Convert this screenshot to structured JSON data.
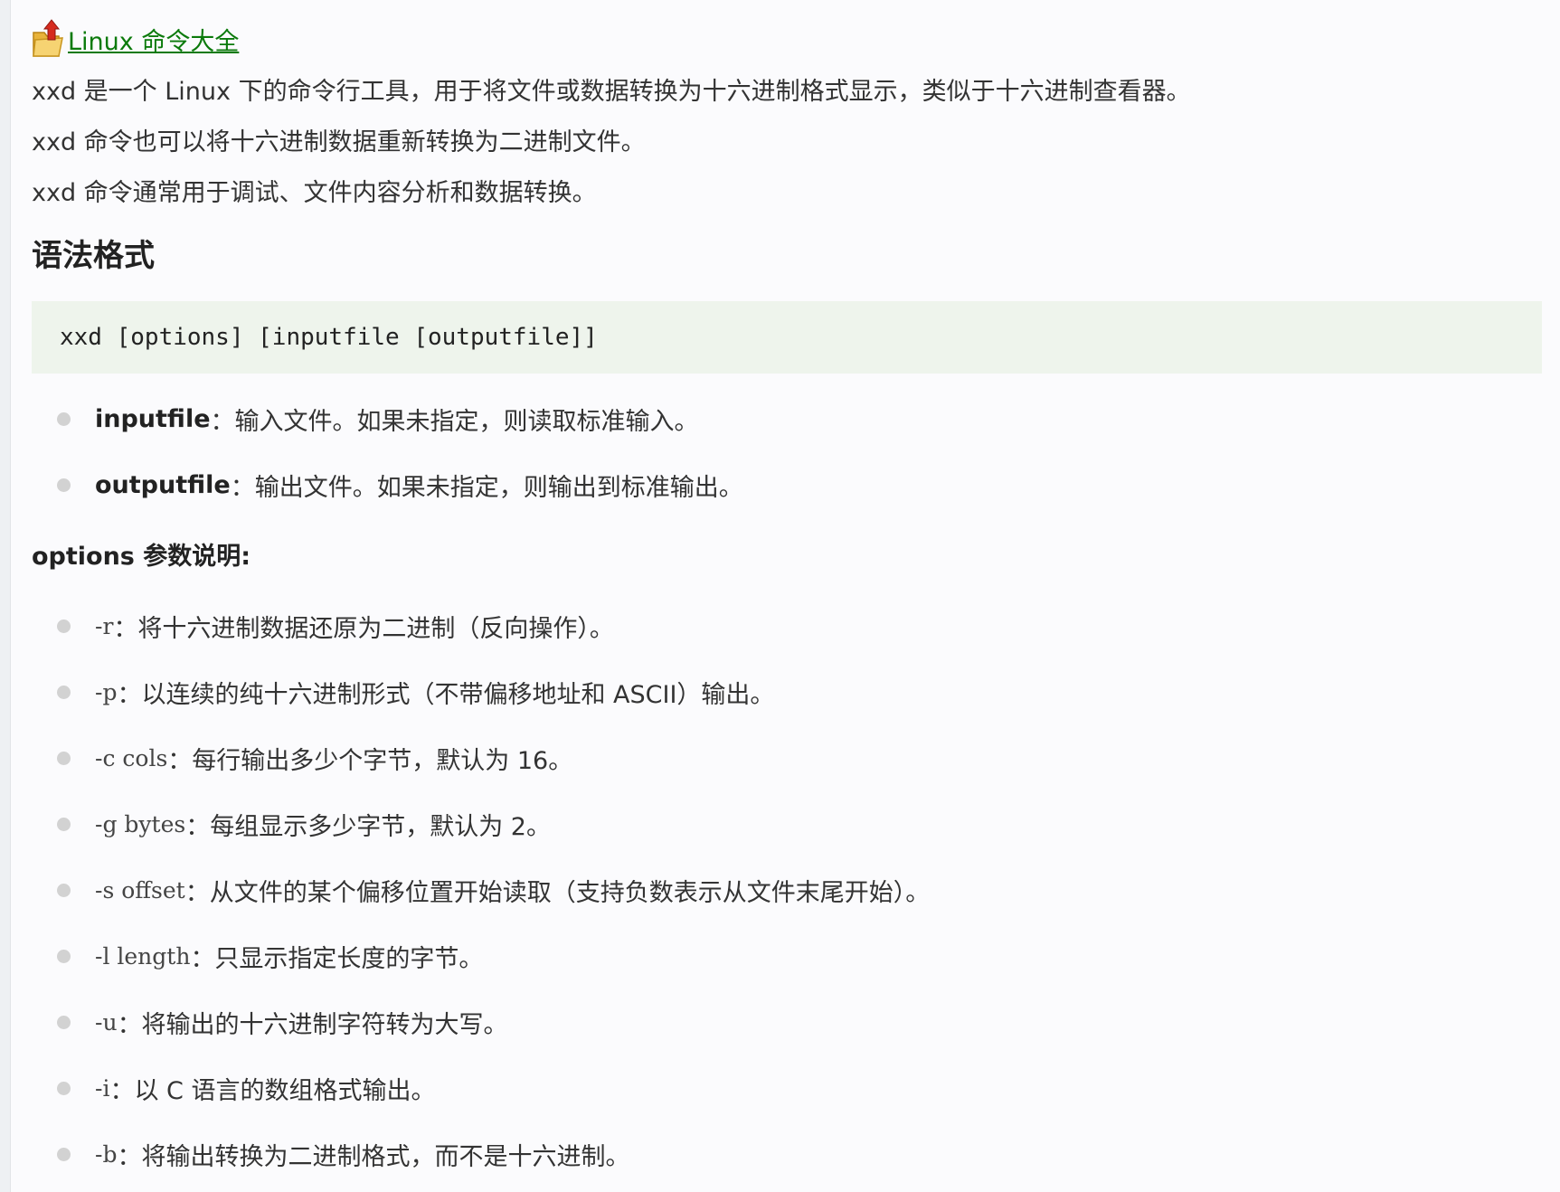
{
  "header": {
    "back_link_label": "Linux 命令大全"
  },
  "intro": [
    "xxd 是一个 Linux 下的命令行工具，用于将文件或数据转换为十六进制格式显示，类似于十六进制查看器。",
    "xxd 命令也可以将十六进制数据重新转换为二进制文件。",
    "xxd 命令通常用于调试、文件内容分析和数据转换。"
  ],
  "syntax": {
    "heading": "语法格式",
    "code": "xxd [options] [inputfile [outputfile]]"
  },
  "params": [
    {
      "name": "inputfile",
      "desc": "：输入文件。如果未指定，则读取标准输入。"
    },
    {
      "name": "outputfile",
      "desc": "：输出文件。如果未指定，则输出到标准输出。"
    }
  ],
  "options": {
    "heading": "options 参数说明:",
    "items": [
      {
        "flag": "-r",
        "desc": "：将十六进制数据还原为二进制（反向操作）。"
      },
      {
        "flag": "-p",
        "desc": "：以连续的纯十六进制形式（不带偏移地址和 ASCII）输出。"
      },
      {
        "flag": "-c cols",
        "desc": "：每行输出多少个字节，默认为 16。"
      },
      {
        "flag": "-g bytes",
        "desc": "：每组显示多少字节，默认为 2。"
      },
      {
        "flag": "-s offset",
        "desc": "：从文件的某个偏移位置开始读取（支持负数表示从文件末尾开始）。"
      },
      {
        "flag": "-l length",
        "desc": "：只显示指定长度的字节。"
      },
      {
        "flag": "-u",
        "desc": "：将输出的十六进制字符转为大写。"
      },
      {
        "flag": "-i",
        "desc": "：以 C 语言的数组格式输出。"
      },
      {
        "flag": "-b",
        "desc": "：将输出转换为二进制格式，而不是十六进制。"
      }
    ]
  },
  "colors": {
    "link": "#0b7a0b",
    "code_bg": "#eef4ec",
    "bullet": "#d2d2d2"
  },
  "icons": {
    "back_link_icon": "folder-up-arrow-icon"
  }
}
